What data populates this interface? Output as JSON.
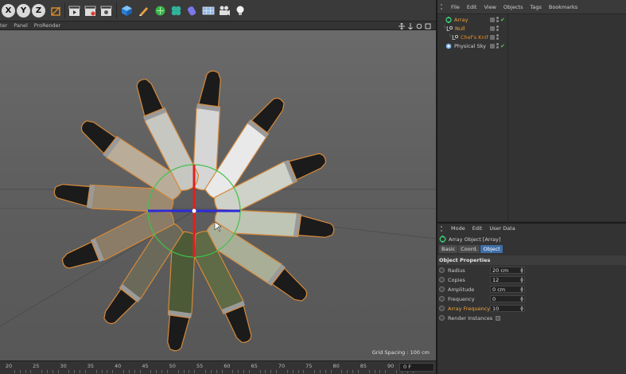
{
  "toolbar": {
    "axis_x": "X",
    "axis_y": "Y",
    "axis_z": "Z"
  },
  "viewport_menu": {
    "items": [
      "ter",
      "Panel",
      "ProRender"
    ]
  },
  "viewport": {
    "grid_spacing": "Grid Spacing : 100 cm"
  },
  "timeline": {
    "ticks": [
      "20",
      "25",
      "30",
      "35",
      "40",
      "45",
      "50",
      "55",
      "60",
      "65",
      "70",
      "75",
      "80",
      "85",
      "90"
    ],
    "frame": "0 F"
  },
  "object_manager": {
    "menu": [
      "File",
      "Edit",
      "View",
      "Objects",
      "Tags",
      "Bookmarks"
    ],
    "objects": [
      {
        "name": "Array",
        "level": 0,
        "color": "#f0a33a",
        "icon": "array-icon"
      },
      {
        "name": "Null",
        "level": 1,
        "color": "#f0a33a",
        "icon": "null-icon"
      },
      {
        "name": "Chef's Knif",
        "level": 2,
        "color": "#f0a33a",
        "icon": "polygon-object-icon"
      },
      {
        "name": "Physical Sky",
        "level": 0,
        "color": "#cfcfcf",
        "icon": "sky-icon"
      }
    ]
  },
  "attribute_manager": {
    "menu": [
      "Mode",
      "Edit",
      "User Data"
    ],
    "title": "Array Object [Array]",
    "tabs": [
      "Basic",
      "Coord.",
      "Object"
    ],
    "active_tab": "Object",
    "section": "Object Properties",
    "properties": [
      {
        "label": "Radius",
        "value": "20 cm",
        "highlight": false
      },
      {
        "label": "Copies",
        "value": "12",
        "highlight": false
      },
      {
        "label": "Amplitude",
        "value": "0 cm",
        "highlight": false
      },
      {
        "label": "Frequency",
        "value": "0",
        "highlight": false
      },
      {
        "label": "Array Frequency",
        "value": "10",
        "highlight": true
      }
    ],
    "render_instances_label": "Render Instances"
  }
}
